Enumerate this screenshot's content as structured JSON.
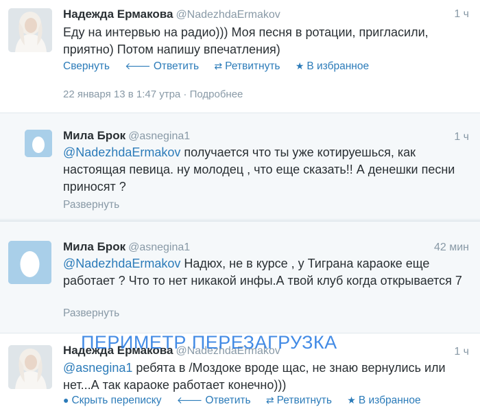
{
  "tweets": [
    {
      "name": "Надежда Ермакова",
      "handle": "@NadezhdaErmakov",
      "time": "1 ч",
      "text": "Еду на интервью на радио))) Моя песня в ротации, пригласили, приятно) Потом напишу впечатления)",
      "actions": [
        "Свернуть",
        "Ответить",
        "Ретвитнуть",
        "В избранное"
      ],
      "meta": "22 января 13 в 1:47 утра · Подробнее"
    },
    {
      "name": "Мила Брок",
      "handle": "@asnegina1",
      "time": "1 ч",
      "mention": "@NadezhdaErmakov",
      "text": " получается что ты уже котируешься, как настоящая певица. ну молодец , что еще сказать!! А денешки песни приносят ?",
      "expand": "Развернуть"
    },
    {
      "name": "Мила Брок",
      "handle": "@asnegina1",
      "time": "42 мин",
      "mention": "@NadezhdaErmakov",
      "text": " Надюх, не в курсе , у Тиграна караоке еще работает ? Что то нет никакой инфы.А твой клуб когда открывается 7",
      "expand": "Развернуть"
    },
    {
      "name": "Надежда Ермакова",
      "handle": "@NadezhdaErmakov",
      "time": "1 ч",
      "mention": "@asnegina1",
      "text": " ребята в /Моздоке вроде щас, не знаю вернулись или нет...А так караоке работает конечно)))",
      "actions": [
        "Скрыть переписку",
        "Ответить",
        "Ретвитнуть",
        "В избранное"
      ]
    }
  ],
  "watermark": "ПЕРИМЕТР ПЕРЕЗАГРУЗКА",
  "icons": {
    "collapse": "none",
    "hide_conversation": "speech-bubble-icon",
    "reply": "reply-arrow-icon",
    "retweet": "retweet-icon",
    "favorite": "star-icon"
  },
  "colors": {
    "link": "#2b7bb9",
    "muted": "#8899a6",
    "egg_avatar": "#a9cfe9",
    "watermark": "#2f7fe3"
  }
}
